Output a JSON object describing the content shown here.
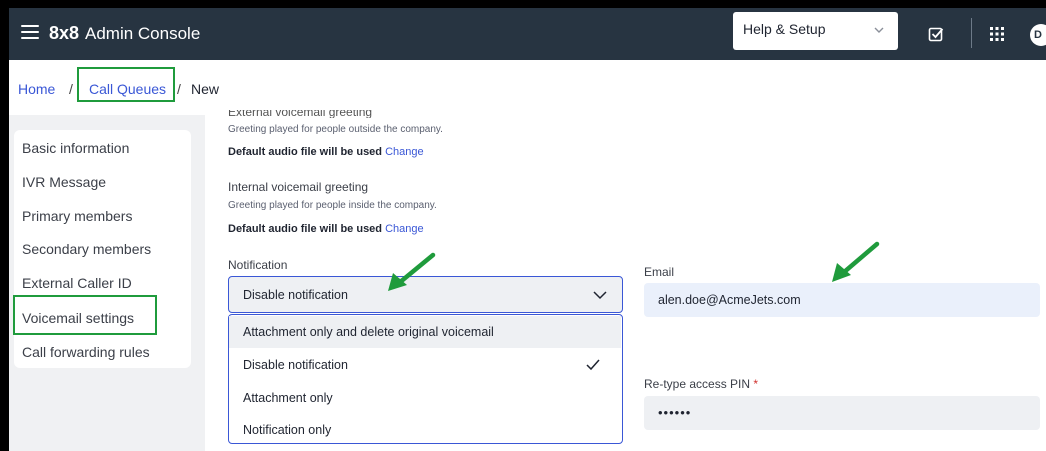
{
  "header": {
    "brand": "8x8",
    "app_name": "Admin Console",
    "help_label": "Help & Setup",
    "avatar_initial": "D"
  },
  "breadcrumb": {
    "items": [
      "Home",
      "Call Queues",
      "New"
    ],
    "separator": "/"
  },
  "sidebar": {
    "items": [
      {
        "label": "Basic information"
      },
      {
        "label": "IVR Message"
      },
      {
        "label": "Primary members"
      },
      {
        "label": "Secondary members"
      },
      {
        "label": "External Caller ID"
      },
      {
        "label": "Voicemail settings"
      },
      {
        "label": "Call forwarding rules"
      }
    ]
  },
  "voicemail": {
    "external_help": "Greeting played for people outside the company.",
    "default_audio_text": "Default audio file will be used",
    "change_link": "Change",
    "internal_title": "Internal voicemail greeting",
    "internal_help": "Greeting played for people inside the company.",
    "notification_label": "Notification",
    "notification_value": "Disable notification",
    "notification_options": [
      "Attachment only and delete original voicemail",
      "Disable notification",
      "Attachment only",
      "Notification only"
    ],
    "email_label": "Email",
    "email_value": "alen.doe@AcmeJets.com",
    "retype_pin_label": "Re-type access PIN",
    "required_mark": "*",
    "pin_value": "••••••"
  },
  "colors": {
    "topbar": "#273441",
    "link": "#3a57d6",
    "annotation_green": "#1f9b3c"
  }
}
